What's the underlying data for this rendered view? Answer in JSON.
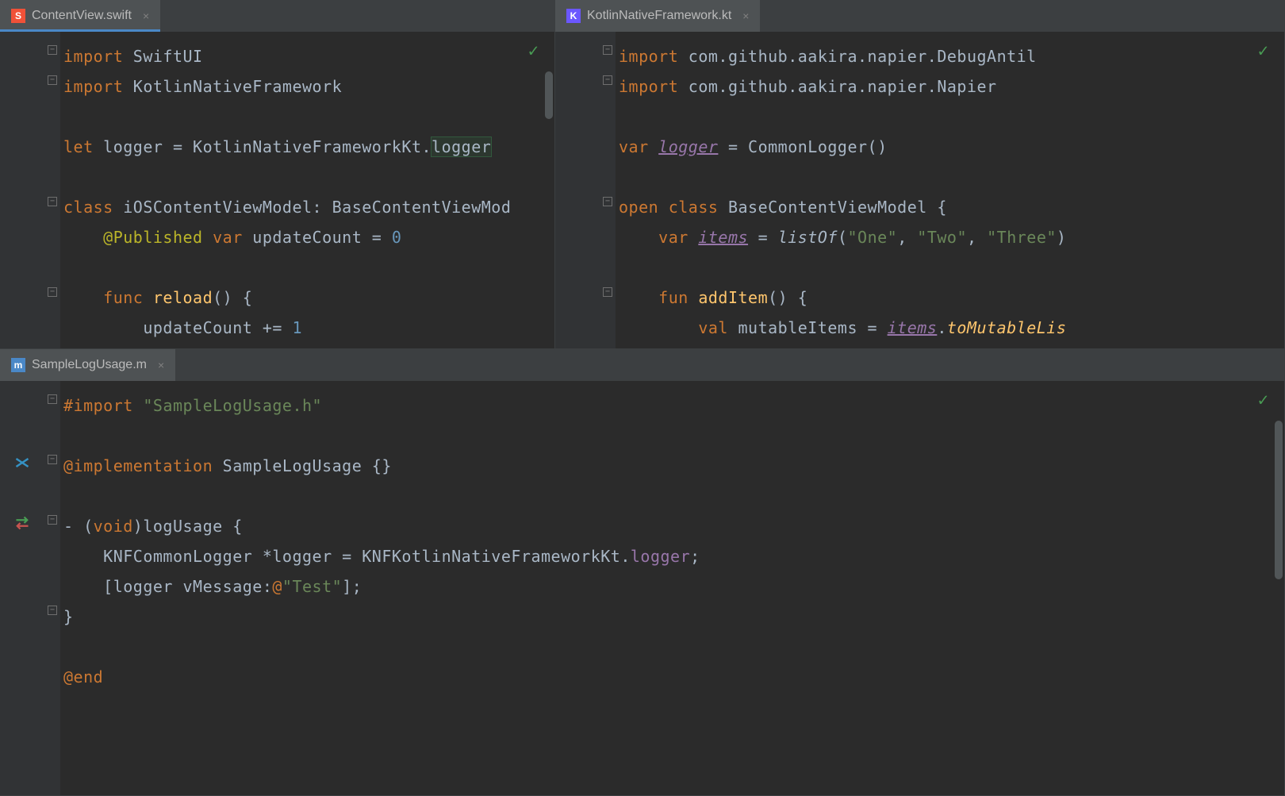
{
  "panes": {
    "topLeft": {
      "tab": {
        "filename": "ContentView.swift",
        "iconLetter": "S"
      },
      "code": {
        "l1_kw": "import",
        "l1_rest": " SwiftUI",
        "l2_kw": "import",
        "l2_rest": " KotlinNativeFramework",
        "l4_kw": "let",
        "l4_var": " logger = ",
        "l4_type": "KotlinNativeFrameworkKt",
        "l4_dot": ".",
        "l4_prop": "logger",
        "l6_kw": "class",
        "l6_name": " iOSContentViewModel: ",
        "l6_base": "BaseContentViewMod",
        "l7_deco": "@Published",
        "l7_kw": " var",
        "l7_rest": " updateCount = ",
        "l7_num": "0",
        "l9_kw": "func",
        "l9_fn": " reload",
        "l9_rest": "() {",
        "l10": "        updateCount += ",
        "l10_num": "1"
      }
    },
    "topRight": {
      "tab": {
        "filename": "KotlinNativeFramework.kt",
        "iconLetter": "K"
      },
      "code": {
        "l1_kw": "import",
        "l1_rest": " com.github.aakira.napier.DebugAntil",
        "l2_kw": "import",
        "l2_rest": " com.github.aakira.napier.Napier",
        "l4_kw": "var",
        "l4_sp": " ",
        "l4_var": "logger",
        "l4_rest": " = CommonLogger()",
        "l6_kw1": "open",
        "l6_kw2": " class",
        "l6_rest": " BaseContentViewModel {",
        "l7_kw": "var",
        "l7_sp": "    ",
        "l7_var": "items",
        "l7_eq": " = ",
        "l7_fn": "listOf",
        "l7_paren": "(",
        "l7_s1": "\"One\"",
        "l7_c1": ", ",
        "l7_s2": "\"Two\"",
        "l7_c2": ", ",
        "l7_s3": "\"Three\"",
        "l7_end": ")",
        "l9_kw": "fun",
        "l9_fn": " addItem",
        "l9_rest": "() {",
        "l10_kw": "val",
        "l10_sp": "        ",
        "l10_rest": " mutableItems = ",
        "l10_var": "items",
        "l10_dot": ".",
        "l10_fn": "toMutableLis"
      }
    },
    "bottom": {
      "tab": {
        "filename": "SampleLogUsage.m",
        "iconLetter": "m"
      },
      "code": {
        "l1_kw": "#import",
        "l1_str": " \"SampleLogUsage.h\"",
        "l3_kw": "@implementation",
        "l3_type": " SampleLogUsage ",
        "l3_br": "{}",
        "l5_pre": "- (",
        "l5_kw": "void",
        "l5_post": ")",
        "l5_fn": "logUsage",
        "l5_rest": " {",
        "l6_ind": "    ",
        "l6_type1": "KNFCommonLogger",
        "l6_mid": " *logger = ",
        "l6_type2": "KNFKotlinNativeFrameworkKt",
        "l6_dot": ".",
        "l6_prop": "logger",
        "l6_semi": ";",
        "l7_ind": "    [logger ",
        "l7_fn": "vMessage",
        "l7_col": ":",
        "l7_at": "@",
        "l7_str": "\"Test\"",
        "l7_end": "];",
        "l8": "}",
        "l10_kw": "@end"
      }
    }
  }
}
